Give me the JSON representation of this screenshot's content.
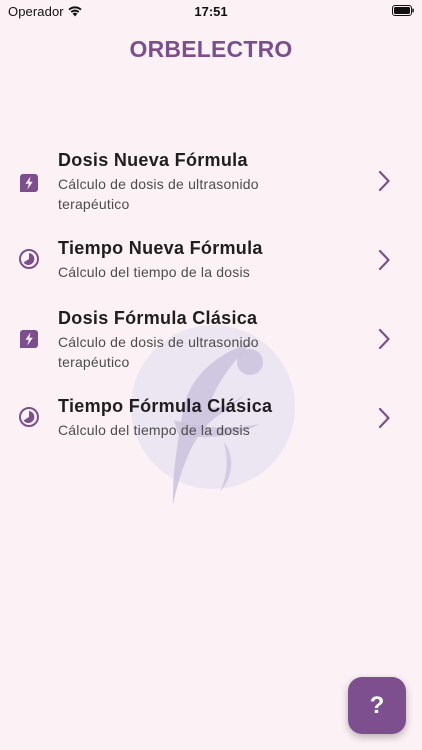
{
  "status_bar": {
    "carrier": "Operador",
    "time": "17:51"
  },
  "header": {
    "title": "ORBELECTRO"
  },
  "menu": {
    "items": [
      {
        "title": "Dosis Nueva Fórmula",
        "subtitle": "Cálculo de dosis de ultrasonido terapéutico",
        "icon": "bolt-icon"
      },
      {
        "title": "Tiempo Nueva Fórmula",
        "subtitle": "Cálculo del tiempo de la dosis",
        "icon": "clock-icon"
      },
      {
        "title": "Dosis Fórmula Clásica",
        "subtitle": "Cálculo de dosis de ultrasonido terapéutico",
        "icon": "bolt-icon"
      },
      {
        "title": "Tiempo Fórmula Clásica",
        "subtitle": "Cálculo del tiempo de la dosis",
        "icon": "clock-icon"
      }
    ]
  },
  "help": {
    "label": "?"
  },
  "colors": {
    "background": "#fcf2f6",
    "accent": "#7c4f8c",
    "text": "#1e1e1e",
    "subtext": "#4c4c4c"
  }
}
